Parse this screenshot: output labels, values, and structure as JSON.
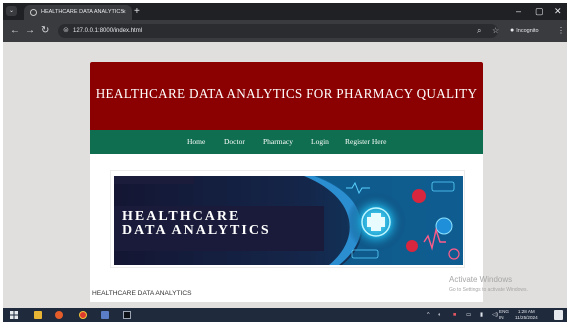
{
  "browser": {
    "tab_title": "HEALTHCARE DATA ANALYTICS",
    "tab_close": "×",
    "new_tab": "+",
    "url": "127.0.0.1:8000/index.html",
    "incognito_label": "Incognito",
    "window_controls": [
      "–",
      "▢",
      "✕"
    ]
  },
  "site": {
    "header_title": "HEALTHCARE DATA ANALYTICS FOR PHARMACY QUALITY",
    "nav": [
      "Home",
      "Doctor",
      "Pharmacy",
      "Login",
      "Register Here"
    ],
    "banner_line1": "HEALTHCARE",
    "banner_line2": "DATA ANALYTICS",
    "caption": "HEALTHCARE DATA ANALYTICS",
    "colors": {
      "header": "#8b0000",
      "nav": "#0f6e4f"
    }
  },
  "os": {
    "watermark_title": "Activate Windows",
    "watermark_sub": "Go to Settings to activate Windows.",
    "lang_top": "ENG",
    "lang_bottom": "IN",
    "time": "1:28 AM",
    "date": "11/25/2024"
  }
}
